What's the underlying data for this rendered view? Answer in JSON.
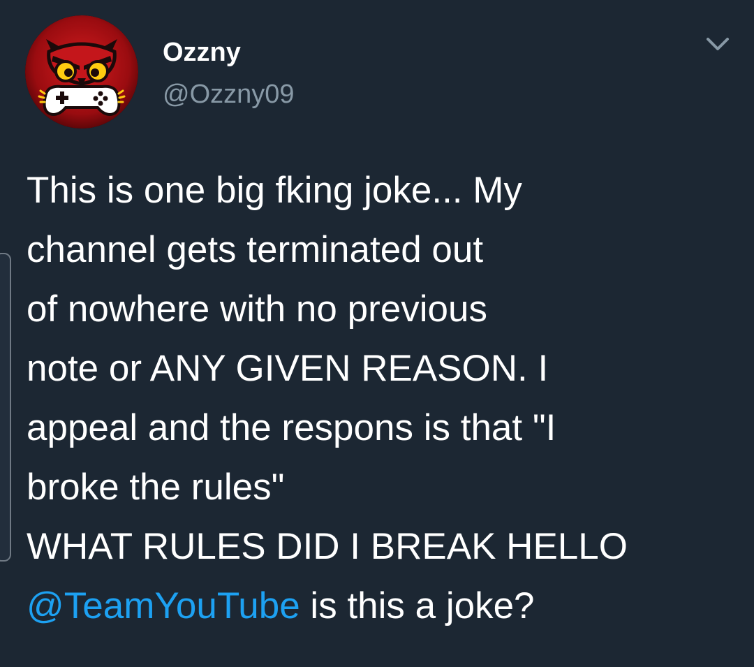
{
  "tweet": {
    "display_name": "Ozzny",
    "handle": "@Ozzny09",
    "avatar_icon": "owl-gamepad-avatar-icon",
    "menu_icon": "chevron-down-icon",
    "text_lines": [
      "This is one big fking joke... My",
      "channel gets terminated out",
      "of nowhere with no previous",
      "note or ANY GIVEN REASON. I",
      "appeal and the respons is that \"I",
      "broke the rules\"",
      "WHAT RULES DID I BREAK HELLO"
    ],
    "mention": "@TeamYouTube",
    "last_line_suffix": " is this a joke?",
    "colors": {
      "background": "#1c2733",
      "text": "#ffffff",
      "handle": "#8899a6",
      "mention": "#1da1f2",
      "chevron": "#8899a6"
    }
  }
}
